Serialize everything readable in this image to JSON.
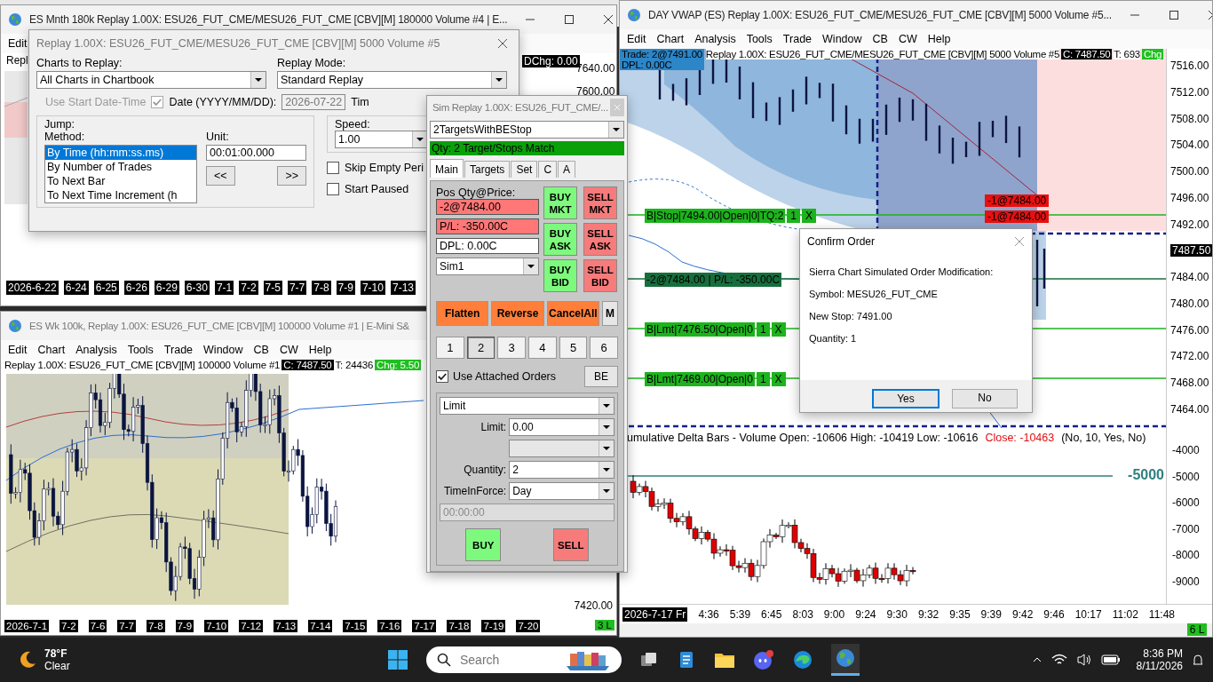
{
  "monthly_window": {
    "title": "ES Mnth 180k Replay 1.00X: ESU26_FUT_CME/MESU26_FUT_CME [CBV][M]  180000 Volume #4 | E...",
    "menu": [
      "Edit"
    ],
    "info": "Repl",
    "dchg": "DChg: 0.00",
    "price_labels": [
      "7640.00",
      "7600.00"
    ],
    "dates": [
      "2026-6-22",
      "6-24",
      "6-25",
      "6-26",
      "6-29",
      "6-30",
      "7-1",
      "7-2",
      "7-5",
      "7-7",
      "7-8",
      "7-9",
      "7-10",
      "7-13"
    ]
  },
  "replay_dialog": {
    "title": "Replay 1.00X: ESU26_FUT_CME/MESU26_FUT_CME [CBV][M]  5000 Volume #5",
    "charts_label": "Charts to Replay:",
    "charts_value": "All Charts in Chartbook",
    "mode_label": "Replay Mode:",
    "mode_value": "Standard Replay",
    "use_start": {
      "label": "Use Start Date-Time",
      "checked": true,
      "disabled": true
    },
    "date_label": "Date (YYYY/MM/DD):",
    "date_value": "2026-07-22",
    "time_label": "Tim",
    "jump_label": "Jump:",
    "method_label": "Method:",
    "methods": [
      {
        "label": "By Time (hh:mm:ss.ms)",
        "selected": true
      },
      {
        "label": "By Number of Trades",
        "selected": false
      },
      {
        "label": "To Next Bar",
        "selected": false
      },
      {
        "label": "To Next Time Increment (h",
        "selected": false
      }
    ],
    "unit_label": "Unit:",
    "unit_value": "00:01:00.000",
    "back_button": "<<",
    "forward_button": ">>",
    "speed_label": "Speed:",
    "speed_value": "1.00",
    "options": [
      {
        "label": "Skip Empty Peri",
        "checked": false
      },
      {
        "label": "Start Paused",
        "checked": false
      }
    ]
  },
  "weekly_window": {
    "title": "ES Wk 100k, Replay 1.00X: ESU26_FUT_CME [CBV][M]  100000 Volume #1 | E-Mini S&",
    "menu": [
      "Edit",
      "Chart",
      "Analysis",
      "Tools",
      "Trade",
      "Window",
      "CB",
      "CW",
      "Help"
    ],
    "info": "Replay 1.00X: ESU26_FUT_CME [CBV][M]  100000 Volume #1",
    "close": "C: 7487.50",
    "trades": "T: 24436",
    "change": "Chg: 5.50",
    "price_label": "7420.00",
    "dates": [
      "2026-7-1",
      "7-2",
      "7-6",
      "7-7",
      "7-8",
      "7-9",
      "7-10",
      "7-12",
      "7-13",
      "7-14",
      "7-15",
      "7-16",
      "7-17",
      "7-18",
      "7-19",
      "7-20"
    ],
    "lines": "3 L"
  },
  "vwap_window": {
    "title": "DAY VWAP (ES) Replay 1.00X: ESU26_FUT_CME/MESU26_FUT_CME [CBV][M]  5000 Volume #5...",
    "menu": [
      "Edit",
      "Chart",
      "Analysis",
      "Tools",
      "Trade",
      "Window",
      "CB",
      "CW",
      "Help"
    ],
    "trade": "Trade: 2@7491.00",
    "dpl": "DPL: 0.00C",
    "info": "Replay 1.00X: ESU26_FUT_CME/MESU26_FUT_CME [CBV][M]  5000 Volume #5",
    "close": "C: 7487.50",
    "trades": "T: 693",
    "change": "Chg",
    "price_axis": [
      "7516.00",
      "7512.00",
      "7508.00",
      "7504.00",
      "7500.00",
      "7496.00",
      "7492.00",
      "7487.50",
      "7484.00",
      "7480.00",
      "7476.00",
      "7472.00",
      "7468.00",
      "7464.00"
    ],
    "order_lines": [
      {
        "kind": "stop",
        "text": "B|Stop|7494.00|Open|0|TQ:2",
        "qty": "1",
        "cancel": "X"
      },
      {
        "kind": "position",
        "text": "-2@7484.00 | P/L: -350.00C"
      },
      {
        "kind": "limit",
        "text": "B|Lmt|7476.50|Open|0",
        "qty": "1",
        "cancel": "X"
      },
      {
        "kind": "limit",
        "text": "B|Lmt|7469.00|Open|0",
        "qty": "1",
        "cancel": "X"
      }
    ],
    "fill_markers": [
      "-1@7484.00",
      "-1@7484.00"
    ],
    "study_header": "umulative Delta Bars - Volume  Open: -10606  High: -10419  Low: -10616",
    "study_close": "Close: -10463",
    "study_params": "(No, 10, Yes, No)",
    "study_line_label": "-5000",
    "study_axis": [
      "-4000",
      "-5000",
      "-6000",
      "-7000",
      "-8000",
      "-9000"
    ],
    "times": [
      "2026-7-17 Fr",
      "4:36",
      "5:39",
      "6:45",
      "8:03",
      "9:00",
      "9:24",
      "9:30",
      "9:32",
      "9:35",
      "9:39",
      "9:42",
      "9:46",
      "10:17",
      "11:02",
      "11:48"
    ],
    "lines": "6 L"
  },
  "trade_window": {
    "title": "Sim Replay 1.00X: ESU26_FUT_CME/...",
    "strategy": "2TargetsWithBEStop",
    "status": "Qty: 2 Target/Stops Match",
    "tabs": [
      {
        "label": "Main",
        "selected": true
      },
      {
        "label": "Targets",
        "selected": false
      },
      {
        "label": "Set",
        "selected": false
      },
      {
        "label": "C",
        "selected": false
      },
      {
        "label": "A",
        "selected": false
      }
    ],
    "pos_label": "Pos Qty@Price:",
    "position": "-2@7484.00",
    "pl": "P/L: -350.00C",
    "dpl": "DPL: 0.00C",
    "account": "Sim1",
    "order_buttons": [
      {
        "kind": "buy",
        "label": "BUY MKT"
      },
      {
        "kind": "sell",
        "label": "SELL MKT"
      },
      {
        "kind": "buy",
        "label": "BUY ASK"
      },
      {
        "kind": "sell",
        "label": "SELL ASK"
      },
      {
        "kind": "buy",
        "label": "BUY BID"
      },
      {
        "kind": "sell",
        "label": "SELL BID"
      }
    ],
    "actions": [
      "Flatten",
      "Reverse",
      "CancelAll"
    ],
    "menu_button": "M",
    "qty_presets": [
      {
        "label": "1",
        "selected": false
      },
      {
        "label": "2",
        "selected": true
      },
      {
        "label": "3",
        "selected": false
      },
      {
        "label": "4",
        "selected": false
      },
      {
        "label": "5",
        "selected": false
      },
      {
        "label": "6",
        "selected": false
      }
    ],
    "attached": {
      "label": "Use Attached Orders",
      "checked": true
    },
    "be_button": "BE",
    "order_type": "Limit",
    "limit_label": "Limit:",
    "limit_value": "0.00",
    "quantity_label": "Quantity:",
    "quantity_value": "2",
    "tif_label": "TimeInForce:",
    "tif_value": "Day",
    "time_value": "00:00:00",
    "buy": "BUY",
    "sell": "SELL"
  },
  "confirm_dialog": {
    "title": "Confirm Order",
    "lines": [
      "Sierra Chart Simulated Order Modification:",
      "Symbol: MESU26_FUT_CME",
      "New Stop: 7491.00",
      "Quantity: 1"
    ],
    "buttons": [
      {
        "label": "Yes",
        "selected": true
      },
      {
        "label": "No",
        "selected": false
      }
    ]
  },
  "taskbar": {
    "temperature": "78°F",
    "weather": "Clear",
    "search_placeholder": "Search",
    "time": "8:36 PM",
    "date": "8/11/2026"
  }
}
